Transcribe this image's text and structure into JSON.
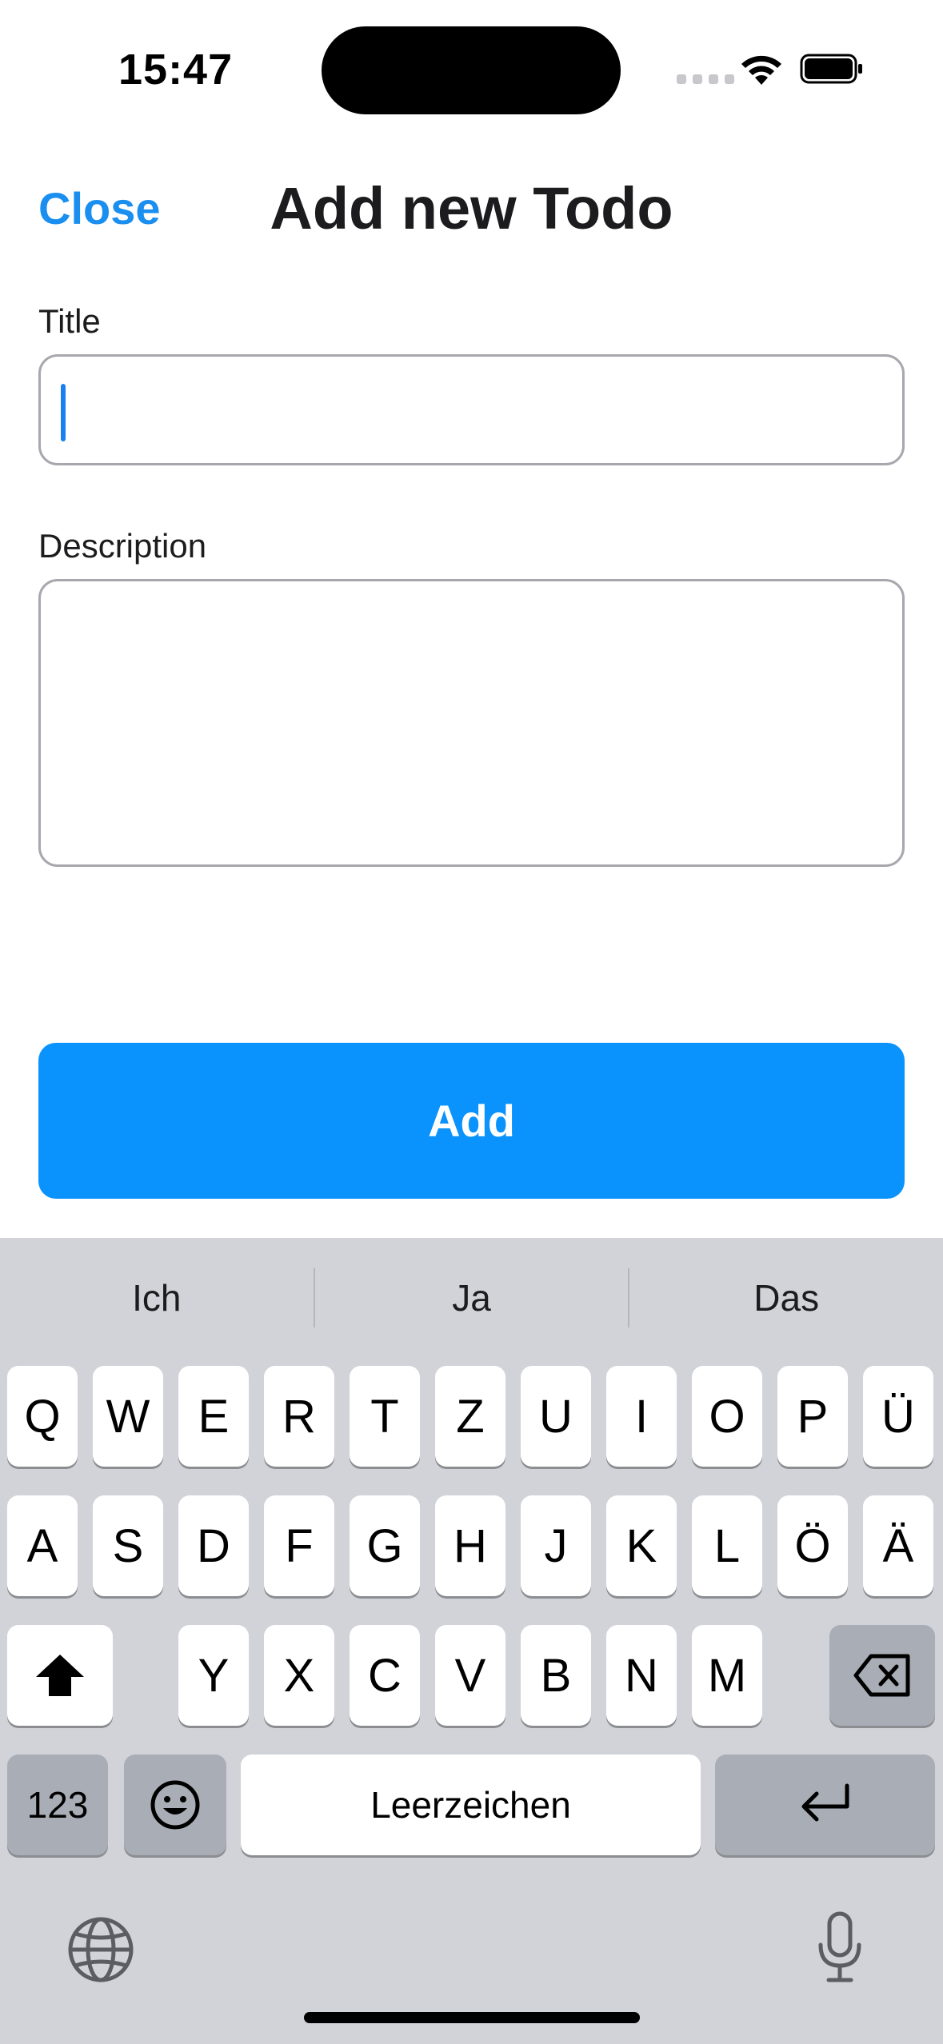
{
  "status_bar": {
    "time": "15:47",
    "icons": [
      "signal-icon",
      "wifi-icon",
      "battery-icon"
    ]
  },
  "header": {
    "close_label": "Close",
    "title": "Add new Todo"
  },
  "form": {
    "title_label": "Title",
    "title_value": "",
    "description_label": "Description",
    "description_value": "",
    "add_label": "Add"
  },
  "colors": {
    "accent": "#0a93fc",
    "link": "#1a8ff0",
    "keyboard_bg": "#d1d3d9"
  },
  "keyboard": {
    "suggestions": [
      "Ich",
      "Ja",
      "Das"
    ],
    "row1": [
      "Q",
      "W",
      "E",
      "R",
      "T",
      "Z",
      "U",
      "I",
      "O",
      "P",
      "Ü"
    ],
    "row2": [
      "A",
      "S",
      "D",
      "F",
      "G",
      "H",
      "J",
      "K",
      "L",
      "Ö",
      "Ä"
    ],
    "row3": [
      "Y",
      "X",
      "C",
      "V",
      "B",
      "N",
      "M"
    ],
    "numbers_label": "123",
    "space_label": "Leerzeichen",
    "icons": [
      "shift-icon",
      "backspace-icon",
      "emoji-icon",
      "return-icon",
      "globe-icon",
      "microphone-icon"
    ]
  }
}
